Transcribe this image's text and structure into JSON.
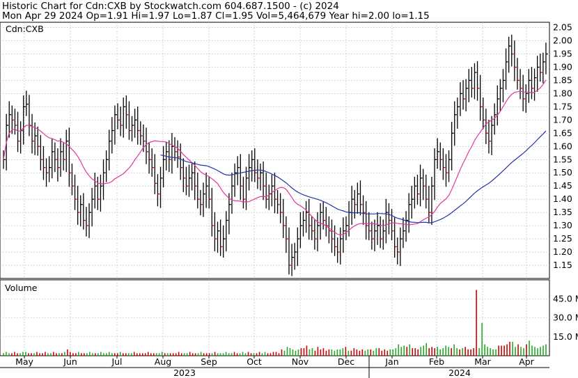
{
  "header": {
    "line1": "Historic Chart for Cdn:CXB by Stockwatch.com 604.687.1500 - (c) 2024",
    "line2": "Mon Apr 29 2024  Op=1.91  Hi=1.97  Lo=1.87  Cl=1.95  Vol=5,464,679  Year hi=2.00  lo=1.15"
  },
  "chart_data": [
    {
      "type": "ohlc",
      "label": "Cdn:CXB",
      "ylim": [
        1.1,
        2.07
      ],
      "yticks": [
        "2.05",
        "2.00",
        "1.95",
        "1.90",
        "1.85",
        "1.80",
        "1.75",
        "1.70",
        "1.65",
        "1.60",
        "1.55",
        "1.50",
        "1.45",
        "1.40",
        "1.35",
        "1.30",
        "1.25",
        "1.20",
        "1.15"
      ],
      "grid": true,
      "months": [
        "May",
        "Jun",
        "Jul",
        "Aug",
        "Sep",
        "Oct",
        "Nov",
        "Dec",
        "Jan",
        "Feb",
        "Mar",
        "Apr"
      ],
      "years": [
        "2023",
        "2024"
      ],
      "colors": {
        "bar": "#000000",
        "tick": "#cc0000",
        "ma_short": "#e0389c",
        "ma_long": "#2233aa",
        "grid": "#bbbbbb",
        "vol_up": "#22aa22",
        "vol_down": "#cc0000"
      },
      "closes": [
        1.55,
        1.68,
        1.72,
        1.7,
        1.68,
        1.62,
        1.66,
        1.75,
        1.76,
        1.68,
        1.62,
        1.64,
        1.6,
        1.55,
        1.52,
        1.5,
        1.52,
        1.58,
        1.55,
        1.52,
        1.58,
        1.55,
        1.62,
        1.5,
        1.45,
        1.4,
        1.35,
        1.38,
        1.32,
        1.3,
        1.35,
        1.4,
        1.45,
        1.4,
        1.45,
        1.5,
        1.55,
        1.62,
        1.66,
        1.72,
        1.7,
        1.68,
        1.75,
        1.72,
        1.66,
        1.68,
        1.7,
        1.66,
        1.64,
        1.62,
        1.58,
        1.55,
        1.52,
        1.46,
        1.42,
        1.48,
        1.55,
        1.58,
        1.55,
        1.6,
        1.58,
        1.56,
        1.52,
        1.48,
        1.45,
        1.48,
        1.5,
        1.45,
        1.4,
        1.38,
        1.42,
        1.45,
        1.4,
        1.3,
        1.25,
        1.28,
        1.22,
        1.25,
        1.32,
        1.38,
        1.45,
        1.5,
        1.52,
        1.45,
        1.4,
        1.48,
        1.52,
        1.55,
        1.5,
        1.48,
        1.5,
        1.45,
        1.4,
        1.42,
        1.45,
        1.4,
        1.38,
        1.35,
        1.3,
        1.25,
        1.15,
        1.18,
        1.2,
        1.25,
        1.3,
        1.32,
        1.35,
        1.3,
        1.28,
        1.25,
        1.3,
        1.35,
        1.32,
        1.3,
        1.28,
        1.25,
        1.22,
        1.2,
        1.25,
        1.28,
        1.3,
        1.35,
        1.4,
        1.38,
        1.42,
        1.38,
        1.35,
        1.3,
        1.28,
        1.25,
        1.28,
        1.3,
        1.25,
        1.28,
        1.35,
        1.32,
        1.28,
        1.22,
        1.2,
        1.25,
        1.28,
        1.32,
        1.38,
        1.4,
        1.45,
        1.42,
        1.48,
        1.45,
        1.4,
        1.35,
        1.45,
        1.55,
        1.58,
        1.55,
        1.52,
        1.5,
        1.55,
        1.65,
        1.72,
        1.75,
        1.8,
        1.78,
        1.82,
        1.85,
        1.82,
        1.88,
        1.82,
        1.75,
        1.7,
        1.65,
        1.62,
        1.68,
        1.72,
        1.78,
        1.82,
        1.85,
        1.92,
        1.98,
        1.95,
        1.9,
        1.85,
        1.82,
        1.78,
        1.8,
        1.85,
        1.82,
        1.86,
        1.9,
        1.88,
        1.92,
        1.95
      ],
      "volume": {
        "label": "Volume",
        "yticks": [
          "45.0 M",
          "30.0 M",
          "15.0 M"
        ],
        "ylim": [
          0,
          60
        ],
        "values": [
          2,
          3,
          2,
          2,
          3,
          2,
          2,
          3,
          3,
          2,
          2,
          2,
          3,
          2,
          2,
          3,
          2,
          2,
          3,
          2,
          2,
          2,
          3,
          5,
          3,
          2,
          2,
          3,
          2,
          2,
          2,
          3,
          2,
          2,
          2,
          3,
          2,
          2,
          3,
          2,
          2,
          2,
          3,
          2,
          2,
          2,
          2,
          3,
          2,
          2,
          2,
          2,
          3,
          2,
          2,
          2,
          2,
          3,
          2,
          2,
          2,
          2,
          2,
          3,
          2,
          2,
          2,
          3,
          2,
          2,
          2,
          3,
          2,
          2,
          2,
          2,
          3,
          2,
          2,
          2,
          3,
          2,
          2,
          3,
          2,
          2,
          3,
          2,
          3,
          2,
          2,
          2,
          3,
          2,
          3,
          2,
          2,
          3,
          3,
          2,
          5,
          4,
          7,
          6,
          5,
          4,
          5,
          6,
          6,
          8,
          5,
          6,
          4,
          7,
          5,
          6,
          4,
          5,
          5,
          4,
          5,
          5,
          6,
          7,
          4,
          4,
          6,
          5,
          4,
          5,
          4,
          5,
          5,
          4,
          6,
          6,
          4,
          5,
          4,
          5,
          5,
          6,
          9,
          7,
          8,
          7,
          9,
          6,
          6,
          5,
          7,
          8,
          10,
          6,
          7,
          6,
          7,
          5,
          6,
          8,
          7,
          6,
          9,
          6,
          5,
          6,
          7,
          5,
          5,
          6,
          52,
          6,
          26,
          9,
          7,
          6,
          5,
          5,
          8,
          8,
          8,
          9,
          11,
          11,
          7,
          9,
          7,
          6,
          9,
          12,
          8,
          7,
          6,
          7,
          8,
          9
        ]
      }
    }
  ]
}
